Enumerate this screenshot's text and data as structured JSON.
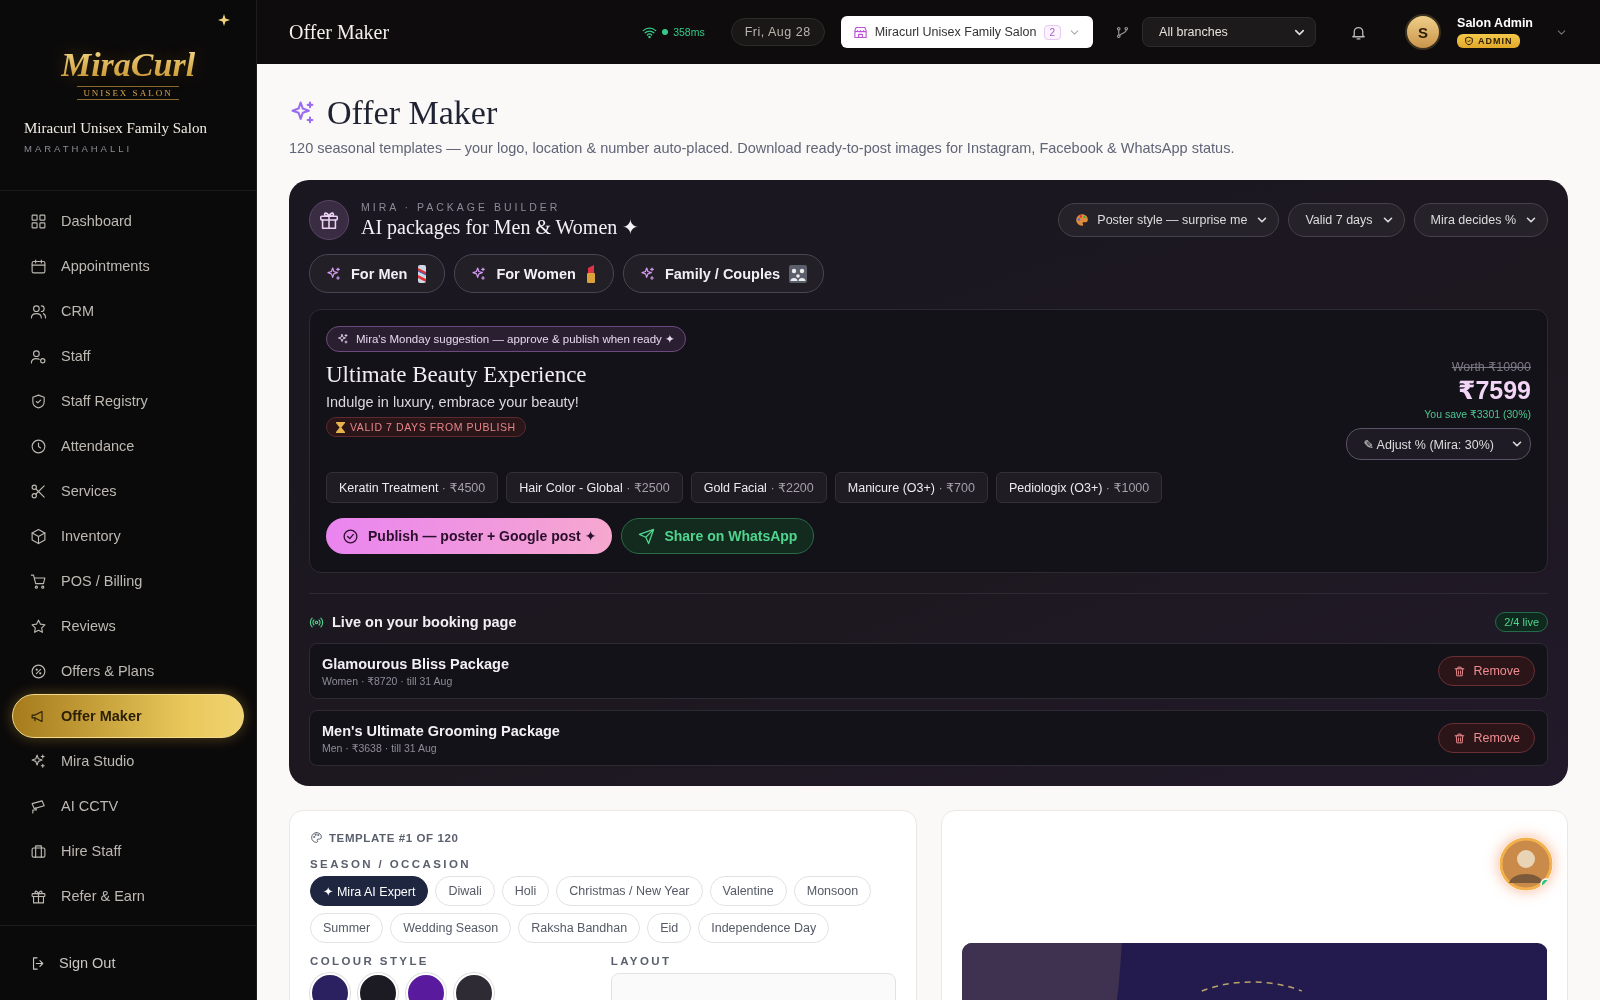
{
  "sidebar": {
    "logo": {
      "wordmark": "MiraCurl",
      "tagline": "UNISEX SALON"
    },
    "salon_name": "Miracurl Unisex Family Salon",
    "location": "MARATHAHALLI",
    "nav_items": [
      {
        "label": "Dashboard",
        "selected": false
      },
      {
        "label": "Appointments",
        "selected": false
      },
      {
        "label": "CRM",
        "selected": false
      },
      {
        "label": "Staff",
        "selected": false
      },
      {
        "label": "Staff Registry",
        "selected": false
      },
      {
        "label": "Attendance",
        "selected": false
      },
      {
        "label": "Services",
        "selected": false
      },
      {
        "label": "Inventory",
        "selected": false
      },
      {
        "label": "POS / Billing",
        "selected": false
      },
      {
        "label": "Reviews",
        "selected": false
      },
      {
        "label": "Offers & Plans",
        "selected": false
      },
      {
        "label": "Offer Maker",
        "selected": true
      },
      {
        "label": "Mira Studio",
        "selected": false
      },
      {
        "label": "AI CCTV",
        "selected": false
      },
      {
        "label": "Hire Staff",
        "selected": false
      },
      {
        "label": "Refer & Earn",
        "selected": false
      }
    ],
    "sign_out": "Sign Out"
  },
  "topbar": {
    "title": "Offer Maker",
    "latency": "358ms",
    "date": "Fri, Aug 28",
    "salon_selector": {
      "label": "Miracurl Unisex Family Salon",
      "count": "2"
    },
    "branch_select": {
      "value": "All branches"
    },
    "user": {
      "initial": "S",
      "name": "Salon Admin",
      "role": "ADMIN"
    }
  },
  "page": {
    "title": "Offer Maker",
    "subtitle": "120 seasonal templates — your logo, location & number auto-placed. Download ready-to-post images for Instagram, Facebook & WhatsApp status."
  },
  "package_builder": {
    "eyebrow": "MIRA · PACKAGE BUILDER",
    "title": "AI packages for Men & Women ✦",
    "selects": [
      {
        "value": "Poster style — surprise me"
      },
      {
        "value": "Valid 7 days"
      },
      {
        "value": "Mira decides %"
      }
    ],
    "audience_tabs": [
      {
        "label": "For Men"
      },
      {
        "label": "For Women"
      },
      {
        "label": "Family / Couples"
      }
    ],
    "suggestion": {
      "note": "Mira's Monday suggestion — approve & publish when ready ✦",
      "title": "Ultimate Beauty Experience",
      "tagline": "Indulge in luxury, embrace your beauty!",
      "validity": "VALID 7 DAYS FROM PUBLISH",
      "worth": "Worth ₹10900",
      "price": "₹7599",
      "savings": "You save ₹3301 (30%)",
      "adjust_select": "✎ Adjust % (Mira: 30%)",
      "services": [
        {
          "name": "Keratin Treatment",
          "price": "· ₹4500"
        },
        {
          "name": "Hair Color - Global",
          "price": "· ₹2500"
        },
        {
          "name": "Gold Facial",
          "price": "· ₹2200"
        },
        {
          "name": "Manicure (O3+)",
          "price": "· ₹700"
        },
        {
          "name": "Pediologix (O3+)",
          "price": "· ₹1000"
        }
      ],
      "publish_button": "Publish — poster + Google post ✦",
      "share_button": "Share on WhatsApp"
    },
    "live": {
      "title": "Live on your booking page",
      "count": "2/4 live",
      "packages": [
        {
          "name": "Glamourous Bliss Package",
          "meta": "Women · ₹8720 · till 31 Aug",
          "action": "Remove"
        },
        {
          "name": "Men's Ultimate Grooming Package",
          "meta": "Men · ₹3638 · till 31 Aug",
          "action": "Remove"
        }
      ]
    }
  },
  "template_panel": {
    "label": "TEMPLATE #1 OF 120",
    "season_label": "SEASON / OCCASION",
    "seasons": [
      {
        "label": "✦ Mira AI Expert",
        "selected": true
      },
      {
        "label": "Diwali",
        "selected": false
      },
      {
        "label": "Holi",
        "selected": false
      },
      {
        "label": "Christmas / New Year",
        "selected": false
      },
      {
        "label": "Valentine",
        "selected": false
      },
      {
        "label": "Monsoon",
        "selected": false
      },
      {
        "label": "Summer",
        "selected": false
      },
      {
        "label": "Wedding Season",
        "selected": false
      },
      {
        "label": "Raksha Bandhan",
        "selected": false
      },
      {
        "label": "Eid",
        "selected": false
      },
      {
        "label": "Independence Day",
        "selected": false
      }
    ],
    "colour_label": "COLOUR STYLE",
    "swatches": [
      {
        "color": "#2b2160"
      },
      {
        "color": "#1c1a22"
      },
      {
        "color": "#5a1a9e"
      },
      {
        "color": "#2e2b35"
      }
    ],
    "layout_label": "LAYOUT"
  }
}
